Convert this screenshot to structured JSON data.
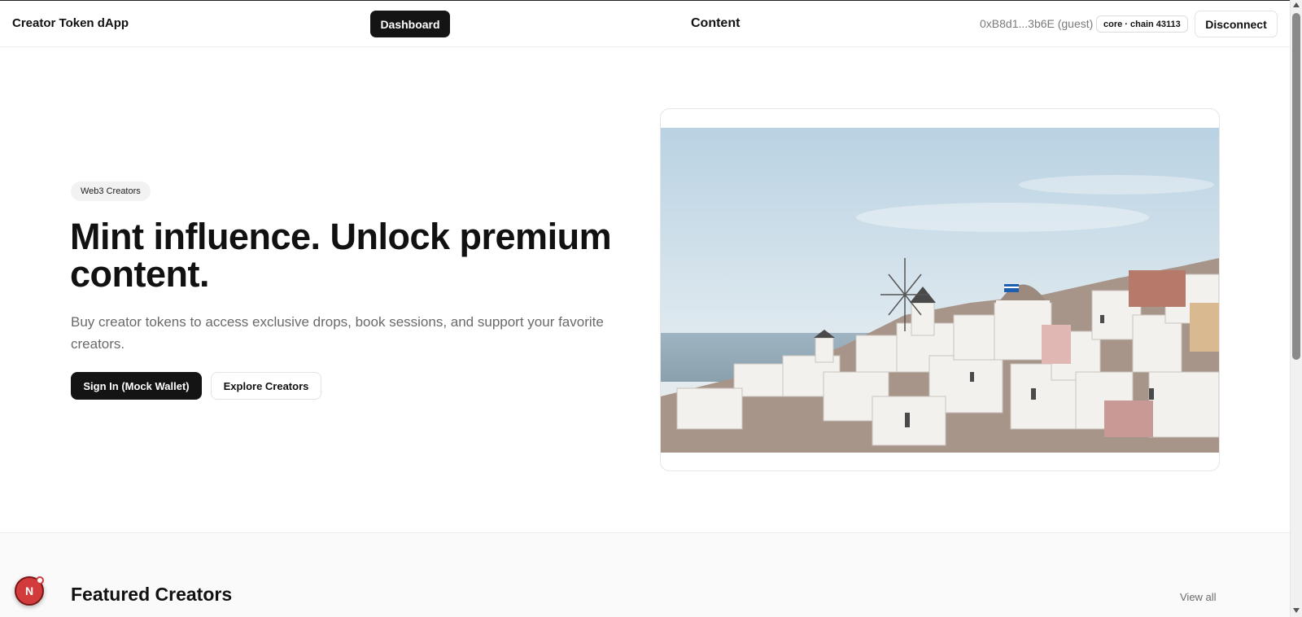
{
  "header": {
    "brand": "Creator Token dApp",
    "dashboard_label": "Dashboard",
    "content_label": "Content",
    "wallet_address": "0xB8d1...3b6E (guest)",
    "chain_badge": "core · chain 43113",
    "disconnect_label": "Disconnect"
  },
  "hero": {
    "pill": "Web3 Creators",
    "title": "Mint influence. Unlock premium content.",
    "subtitle": "Buy creator tokens to access exclusive drops, book sessions, and support your favorite creators.",
    "primary_cta": "Sign In (Mock Wallet)",
    "secondary_cta": "Explore Creators",
    "image_icon": "hero-photo-santorini"
  },
  "featured": {
    "title": "Featured Creators",
    "view_all": "View all"
  },
  "dev_badge": {
    "letter": "N"
  },
  "colors": {
    "primary": "#141414",
    "muted": "#6a6a6a",
    "border": "#e3e3e3",
    "badge": "#d23b3b"
  }
}
